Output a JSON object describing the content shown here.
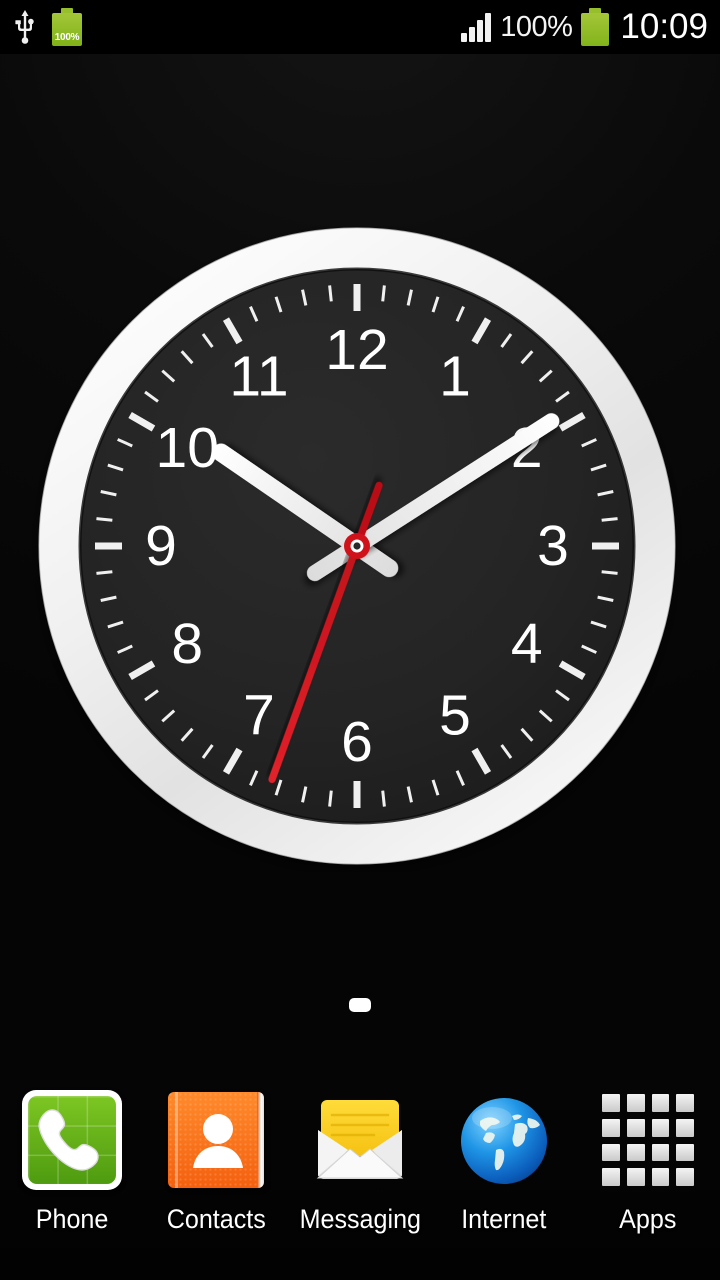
{
  "status_bar": {
    "usb_icon": "usb-icon",
    "battery_left_icon": "battery-charging-icon",
    "battery_left_percent": "100%",
    "signal_icon": "signal-bars-icon",
    "signal_bars_filled": 4,
    "signal_bars_total": 4,
    "battery_percent_text": "100%",
    "battery_right_icon": "battery-icon",
    "time": "10:09"
  },
  "clock_widget": {
    "name": "analog-clock-widget",
    "hours": 10,
    "minutes": 9,
    "seconds": 33,
    "hour_angle_deg": 304.5,
    "minute_angle_deg": 57.3,
    "second_angle_deg": 200,
    "numerals": [
      "12",
      "1",
      "2",
      "3",
      "4",
      "5",
      "6",
      "7",
      "8",
      "9",
      "10",
      "11"
    ],
    "face_color": "#222222",
    "bezel_color": "#f2f2f2",
    "numeral_color": "#ffffff",
    "hour_hand_color": "#f5f5f5",
    "minute_hand_color": "#f5f5f5",
    "second_hand_color": "#d0121b",
    "center_cap_color": "#d0121b"
  },
  "page_indicator": {
    "name": "home-screen-page-indicator",
    "pages": 1,
    "active_index": 0
  },
  "dock": {
    "items": [
      {
        "label": "Phone",
        "icon": "phone-handset-icon",
        "color": "#5aa814"
      },
      {
        "label": "Contacts",
        "icon": "contacts-book-icon",
        "color": "#f4600e"
      },
      {
        "label": "Messaging",
        "icon": "envelope-icon",
        "color": "#fcd116"
      },
      {
        "label": "Internet",
        "icon": "globe-icon",
        "color": "#1a8fe0"
      },
      {
        "label": "Apps",
        "icon": "apps-grid-icon",
        "color": "#e6e6e6"
      }
    ]
  }
}
